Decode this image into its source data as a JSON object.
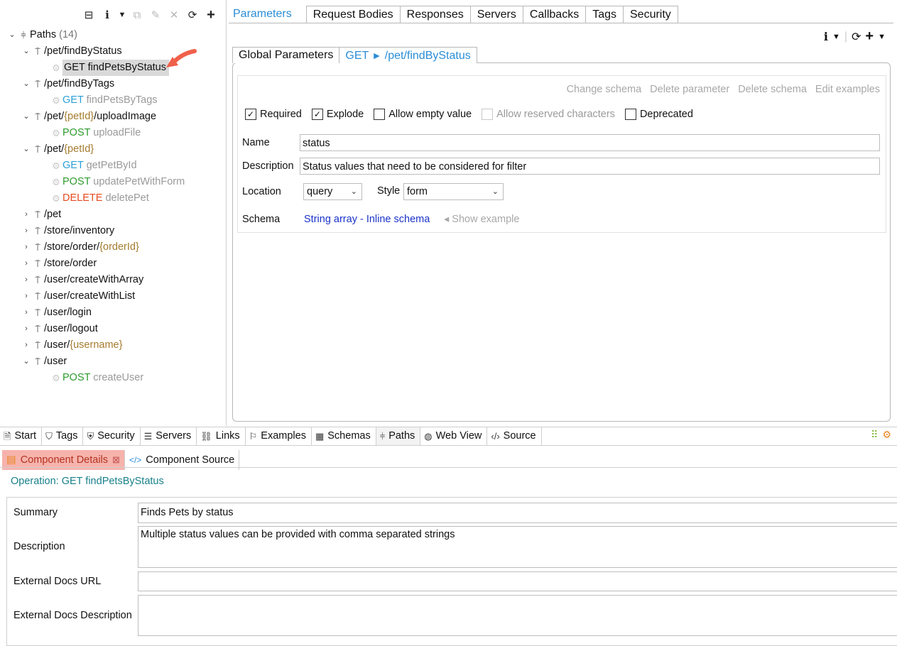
{
  "tree": {
    "root_label": "Paths",
    "root_count": "(14)",
    "items": [
      {
        "type": "path",
        "parts": [
          "/pet/findByStatus"
        ],
        "expanded": true
      },
      {
        "type": "op",
        "method": "GET",
        "name": "findPetsByStatus",
        "selected": true
      },
      {
        "type": "path",
        "parts": [
          "/pet/findByTags"
        ],
        "expanded": true
      },
      {
        "type": "op",
        "method": "GET",
        "name": "findPetsByTags"
      },
      {
        "type": "path",
        "parts": [
          "/pet/",
          "{petId}",
          "/uploadImage"
        ],
        "expanded": true
      },
      {
        "type": "op",
        "method": "POST",
        "name": "uploadFile"
      },
      {
        "type": "path",
        "parts": [
          "/pet/",
          "{petId}"
        ],
        "expanded": true
      },
      {
        "type": "op",
        "method": "GET",
        "name": "getPetById"
      },
      {
        "type": "op",
        "method": "POST",
        "name": "updatePetWithForm"
      },
      {
        "type": "op",
        "method": "DELETE",
        "name": "deletePet"
      },
      {
        "type": "path",
        "parts": [
          "/pet"
        ],
        "expanded": false
      },
      {
        "type": "path",
        "parts": [
          "/store/inventory"
        ],
        "expanded": false
      },
      {
        "type": "path",
        "parts": [
          "/store/order/",
          "{orderId}"
        ],
        "expanded": false
      },
      {
        "type": "path",
        "parts": [
          "/store/order"
        ],
        "expanded": false
      },
      {
        "type": "path",
        "parts": [
          "/user/createWithArray"
        ],
        "expanded": false
      },
      {
        "type": "path",
        "parts": [
          "/user/createWithList"
        ],
        "expanded": false
      },
      {
        "type": "path",
        "parts": [
          "/user/login"
        ],
        "expanded": false
      },
      {
        "type": "path",
        "parts": [
          "/user/logout"
        ],
        "expanded": false
      },
      {
        "type": "path",
        "parts": [
          "/user/",
          "{username}"
        ],
        "expanded": false
      },
      {
        "type": "path",
        "parts": [
          "/user"
        ],
        "expanded": true
      },
      {
        "type": "op",
        "method": "POST",
        "name": "createUser"
      }
    ]
  },
  "top_tabs": [
    "Parameters",
    "Request Bodies",
    "Responses",
    "Servers",
    "Callbacks",
    "Tags",
    "Security"
  ],
  "inner_tabs": {
    "global": "Global Parameters",
    "method": "GET",
    "arrow": "►",
    "path": "/pet/findByStatus"
  },
  "actions": [
    "Change schema",
    "Delete parameter",
    "Delete schema",
    "Edit examples"
  ],
  "checkboxes": [
    {
      "label": "Required",
      "checked": true,
      "enabled": true
    },
    {
      "label": "Explode",
      "checked": true,
      "enabled": true
    },
    {
      "label": "Allow empty value",
      "checked": false,
      "enabled": true
    },
    {
      "label": "Allow reserved characters",
      "checked": false,
      "enabled": false
    },
    {
      "label": "Deprecated",
      "checked": false,
      "enabled": true
    }
  ],
  "form": {
    "name_label": "Name",
    "name_value": "status",
    "desc_label": "Description",
    "desc_value": "Status values that need to be considered for filter",
    "location_label": "Location",
    "location_value": "query",
    "style_label": "Style",
    "style_value": "form",
    "schema_label": "Schema",
    "schema_link": "String array - Inline schema",
    "show_example": "◂ Show example"
  },
  "bottom_tabs": [
    {
      "label": "Start",
      "icon": "document-icon"
    },
    {
      "label": "Tags",
      "icon": "tag-icon"
    },
    {
      "label": "Security",
      "icon": "shield-icon"
    },
    {
      "label": "Servers",
      "icon": "server-icon"
    },
    {
      "label": "Links",
      "icon": "link-icon"
    },
    {
      "label": "Examples",
      "icon": "examples-icon"
    },
    {
      "label": "Schemas",
      "icon": "schemas-icon"
    },
    {
      "label": "Paths",
      "icon": "paths-icon",
      "active": true
    },
    {
      "label": "Web View",
      "icon": "globe-icon"
    },
    {
      "label": "Source",
      "icon": "code-icon"
    }
  ],
  "details": {
    "tab1": "Component Details",
    "tab1_close": "⊠",
    "tab2": "Component Source",
    "operation_title": "Operation: GET findPetsByStatus",
    "summary_label": "Summary",
    "summary_value": "Finds Pets by status",
    "description_label": "Description",
    "description_value": "Multiple status values can be provided with comma separated strings",
    "ext_url_label": "External Docs URL",
    "ext_url_value": "",
    "ext_desc_label": "External Docs Description",
    "ext_desc_value": ""
  },
  "colors": {
    "accent": "#2a8dd6",
    "get": "#2aa0d8",
    "post": "#2e9a2e",
    "delete": "#e84a1f",
    "param": "#a57c2e",
    "highlight": "#f6b3ac",
    "arrow": "#f0604a"
  }
}
